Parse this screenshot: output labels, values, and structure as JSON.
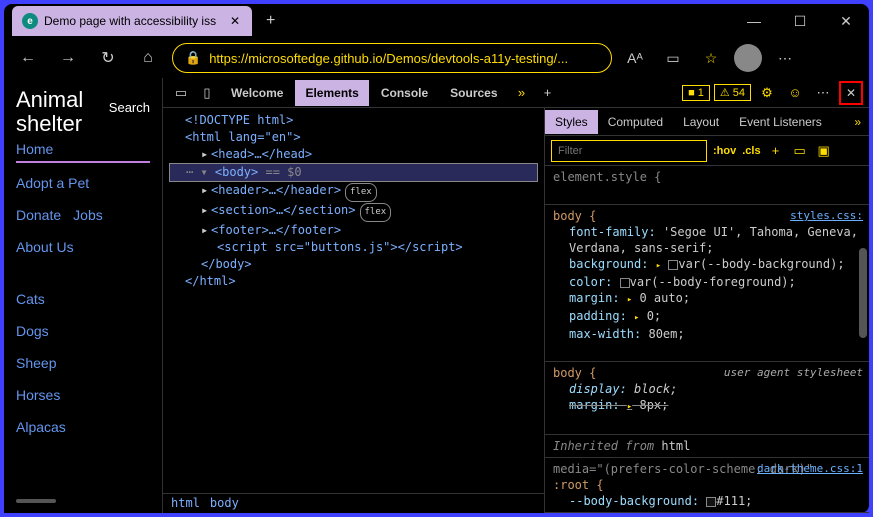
{
  "browser": {
    "tab_title": "Demo page with accessibility iss",
    "url": "https://microsoftedge.github.io/Demos/devtools-a11y-testing/..."
  },
  "page": {
    "title": "Animal shelter",
    "search_label": "Search",
    "nav": {
      "home": "Home",
      "adopt": "Adopt a Pet",
      "donate": "Donate",
      "jobs": "Jobs",
      "about": "About Us",
      "cats": "Cats",
      "dogs": "Dogs",
      "sheep": "Sheep",
      "horses": "Horses",
      "alpacas": "Alpacas"
    }
  },
  "devtools": {
    "tabs": {
      "welcome": "Welcome",
      "elements": "Elements",
      "console": "Console",
      "sources": "Sources"
    },
    "badges": {
      "err": "1",
      "warn": "54"
    },
    "dom": {
      "doctype": "<!DOCTYPE html>",
      "html_open": "<html lang=\"en\">",
      "head": "<head>…</head>",
      "body_sel": "<body> == $0",
      "header": "<header>…</header>",
      "section": "<section>…</section>",
      "footer": "<footer>…</footer>",
      "script": "<script src=\"buttons.js\"></script​>",
      "body_close": "</body>",
      "html_close": "</html>",
      "flex": "flex"
    },
    "breadcrumb": {
      "a": "html",
      "b": "body"
    },
    "styles_tabs": {
      "styles": "Styles",
      "computed": "Computed",
      "layout": "Layout",
      "events": "Event Listeners"
    },
    "filter": {
      "placeholder": "Filter",
      "hov": ":hov",
      "cls": ".cls"
    },
    "rules": {
      "element_style": "element.style {",
      "body_open": "body {",
      "link_styles": "styles.css:",
      "font_family": "font-family: 'Segoe UI', Tahoma, Geneva, Verdana, sans-serif;",
      "background": "background:",
      "bg_val": "var(--body-background);",
      "color": "color:",
      "color_val": "var(--body-foreground);",
      "margin": "margin:",
      "margin_val": "0 auto;",
      "padding": "padding:",
      "padding_val": "0;",
      "maxwidth": "max-width: 80em;",
      "close": "}",
      "ua_label": "user agent stylesheet",
      "display": "display: block;",
      "margin8": "margin: 8px;",
      "inherited": "Inherited from",
      "inherited_kw": "html",
      "media": "media=\"(prefers-color-scheme: dark)\"",
      "root": ":root {",
      "link_dark": "dark-theme.css:1",
      "body_bg_var": "--body-background:",
      "body_bg_val": "#111;"
    }
  }
}
